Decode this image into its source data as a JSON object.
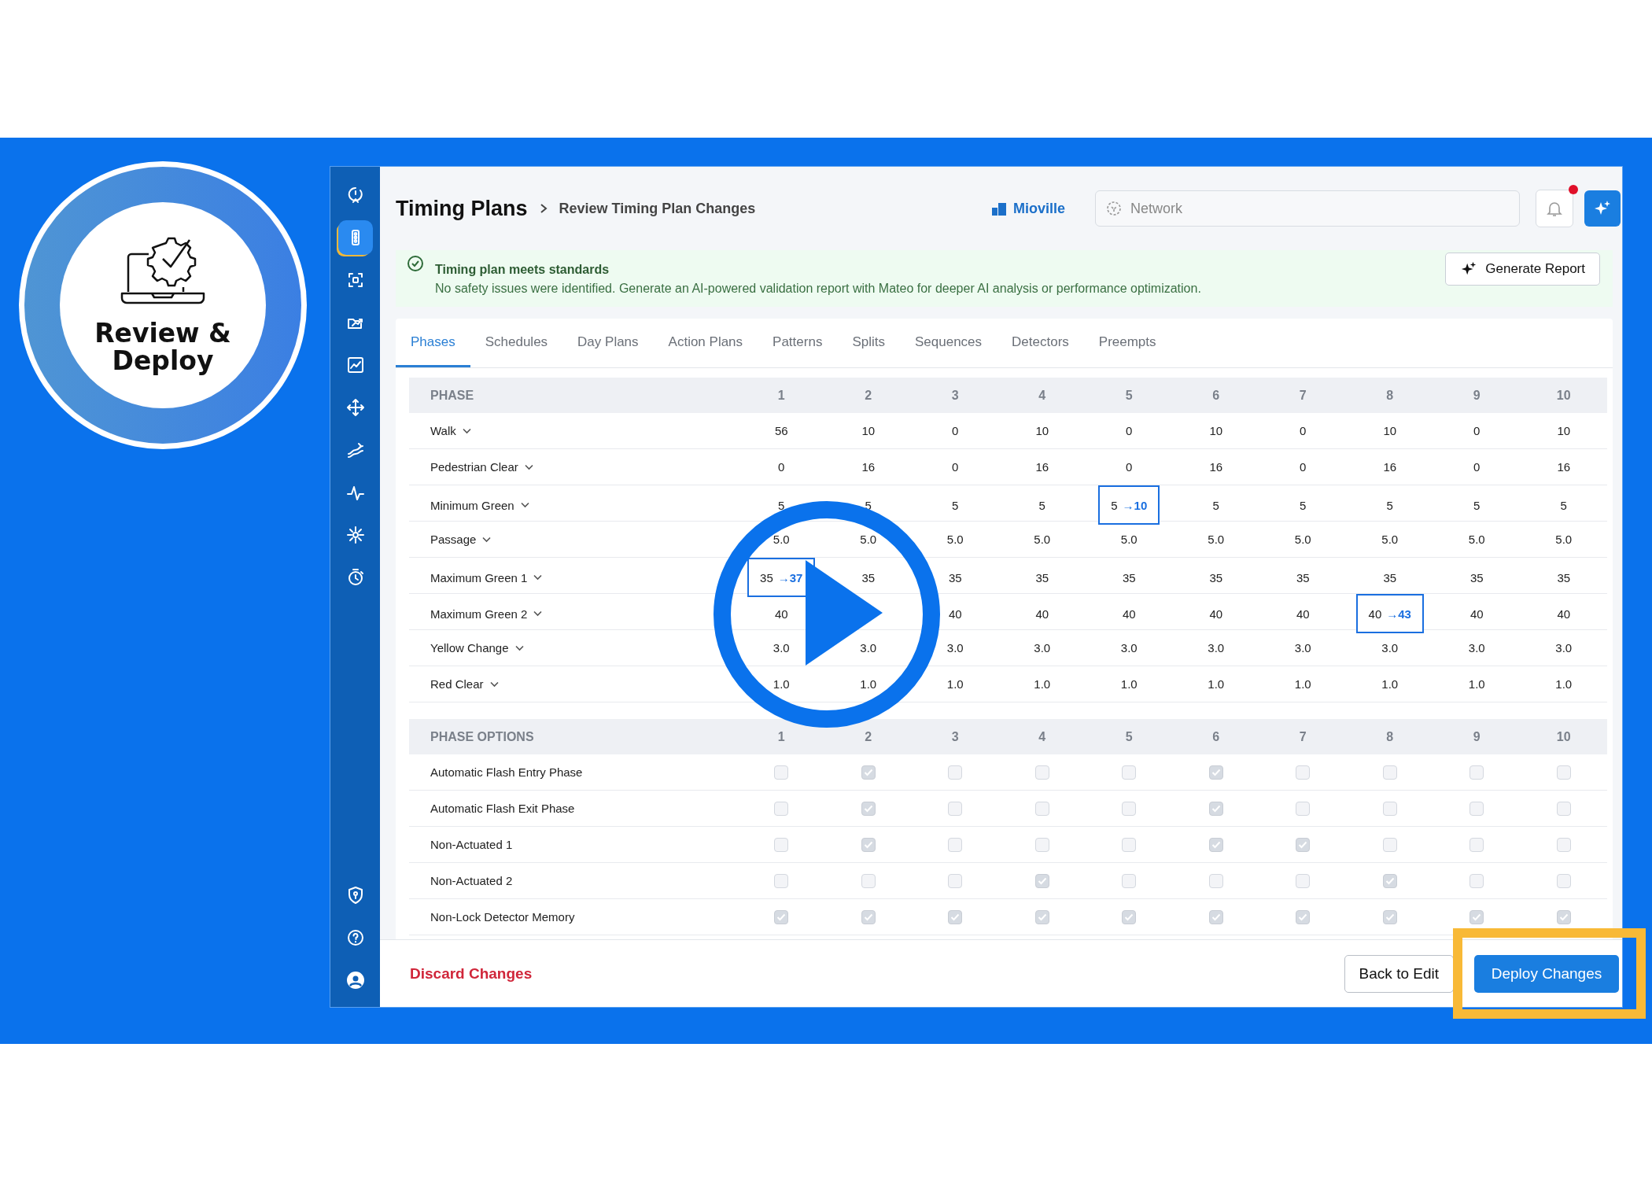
{
  "badge": {
    "title": "Review & Deploy"
  },
  "sidebar": {
    "items": [
      {
        "selected": false
      },
      {
        "selected": true
      },
      {
        "selected": false
      },
      {
        "selected": false
      },
      {
        "selected": false
      },
      {
        "selected": false
      },
      {
        "selected": false
      },
      {
        "selected": false
      },
      {
        "selected": false
      },
      {
        "selected": false
      }
    ],
    "bottom_items": [
      {
        "selected": false
      },
      {
        "selected": false
      },
      {
        "selected": false
      }
    ]
  },
  "header": {
    "title": "Timing Plans",
    "breadcrumb": "Review Timing Plan Changes",
    "city": "Mioville",
    "search": {
      "placeholder": "Network"
    },
    "notification_dot": true
  },
  "banner": {
    "title": "Timing plan meets standards",
    "message": "No safety issues were identified. Generate an AI-powered validation report with Mateo for deeper AI analysis or performance optimization.",
    "button": "Generate Report"
  },
  "tabs": [
    {
      "label": "Phases",
      "selected": true
    },
    {
      "label": "Schedules",
      "selected": false
    },
    {
      "label": "Day Plans",
      "selected": false
    },
    {
      "label": "Action Plans",
      "selected": false
    },
    {
      "label": "Patterns",
      "selected": false
    },
    {
      "label": "Splits",
      "selected": false
    },
    {
      "label": "Sequences",
      "selected": false
    },
    {
      "label": "Detectors",
      "selected": false
    },
    {
      "label": "Preempts",
      "selected": false
    }
  ],
  "phase_table": {
    "title": "PHASE",
    "columns": [
      "1",
      "2",
      "3",
      "4",
      "5",
      "6",
      "7",
      "8",
      "9",
      "10"
    ],
    "rows": [
      {
        "label": "Walk",
        "cells": [
          "56",
          "10",
          "0",
          "10",
          "0",
          "10",
          "0",
          "10",
          "0",
          "10"
        ]
      },
      {
        "label": "Pedestrian Clear",
        "cells": [
          "0",
          "16",
          "0",
          "16",
          "0",
          "16",
          "0",
          "16",
          "0",
          "16"
        ]
      },
      {
        "label": "Minimum Green",
        "cells": [
          "5",
          "5",
          "5",
          "5",
          {
            "old": "5",
            "new": "→10"
          },
          "5",
          "5",
          "5",
          "5",
          "5"
        ]
      },
      {
        "label": "Passage",
        "cells": [
          "5.0",
          "5.0",
          "5.0",
          "5.0",
          "5.0",
          "5.0",
          "5.0",
          "5.0",
          "5.0",
          "5.0"
        ]
      },
      {
        "label": "Maximum Green 1",
        "cells": [
          {
            "old": "35",
            "new": "→37"
          },
          "35",
          "35",
          "35",
          "35",
          "35",
          "35",
          "35",
          "35",
          "35"
        ]
      },
      {
        "label": "Maximum Green 2",
        "cells": [
          "40",
          null,
          "40",
          "40",
          "40",
          "40",
          "40",
          {
            "old": "40",
            "new": "→43"
          },
          "40",
          "40"
        ]
      },
      {
        "label": "Yellow Change",
        "cells": [
          "3.0",
          "3.0",
          "3.0",
          "3.0",
          "3.0",
          "3.0",
          "3.0",
          "3.0",
          "3.0",
          "3.0"
        ]
      },
      {
        "label": "Red Clear",
        "cells": [
          "1.0",
          "1.0",
          "1.0",
          "1.0",
          "1.0",
          "1.0",
          "1.0",
          "1.0",
          "1.0",
          "1.0"
        ]
      }
    ]
  },
  "options_table": {
    "title": "PHASE OPTIONS",
    "columns": [
      "1",
      "2",
      "3",
      "4",
      "5",
      "6",
      "7",
      "8",
      "9",
      "10"
    ],
    "rows": [
      {
        "label": "Automatic Flash Entry Phase",
        "checked": [
          false,
          true,
          false,
          false,
          false,
          true,
          false,
          false,
          false,
          false
        ]
      },
      {
        "label": "Automatic Flash Exit Phase",
        "checked": [
          false,
          true,
          false,
          false,
          false,
          true,
          false,
          false,
          false,
          false
        ]
      },
      {
        "label": "Non-Actuated 1",
        "checked": [
          false,
          true,
          false,
          false,
          false,
          true,
          true,
          false,
          false,
          false
        ]
      },
      {
        "label": "Non-Actuated 2",
        "checked": [
          false,
          false,
          false,
          true,
          false,
          false,
          false,
          true,
          false,
          false
        ]
      },
      {
        "label": "Non-Lock Detector Memory",
        "checked": [
          true,
          true,
          true,
          true,
          true,
          true,
          true,
          true,
          true,
          true
        ]
      }
    ]
  },
  "footer": {
    "discard": "Discard Changes",
    "back": "Back to Edit",
    "deploy": "Deploy Changes"
  }
}
